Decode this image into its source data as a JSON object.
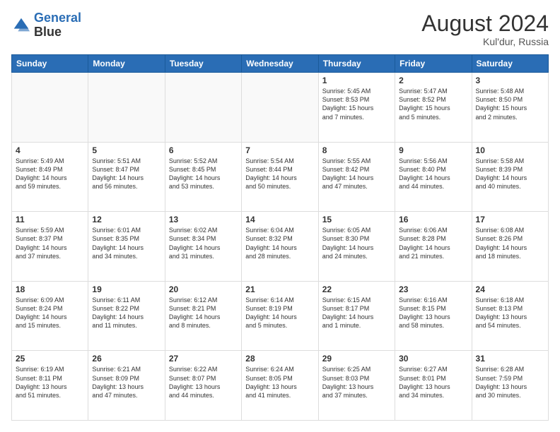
{
  "header": {
    "logo_line1": "General",
    "logo_line2": "Blue",
    "main_title": "August 2024",
    "subtitle": "Kul'dur, Russia"
  },
  "days_of_week": [
    "Sunday",
    "Monday",
    "Tuesday",
    "Wednesday",
    "Thursday",
    "Friday",
    "Saturday"
  ],
  "weeks": [
    [
      {
        "day": "",
        "info": ""
      },
      {
        "day": "",
        "info": ""
      },
      {
        "day": "",
        "info": ""
      },
      {
        "day": "",
        "info": ""
      },
      {
        "day": "1",
        "info": "Sunrise: 5:45 AM\nSunset: 8:53 PM\nDaylight: 15 hours\nand 7 minutes."
      },
      {
        "day": "2",
        "info": "Sunrise: 5:47 AM\nSunset: 8:52 PM\nDaylight: 15 hours\nand 5 minutes."
      },
      {
        "day": "3",
        "info": "Sunrise: 5:48 AM\nSunset: 8:50 PM\nDaylight: 15 hours\nand 2 minutes."
      }
    ],
    [
      {
        "day": "4",
        "info": "Sunrise: 5:49 AM\nSunset: 8:49 PM\nDaylight: 14 hours\nand 59 minutes."
      },
      {
        "day": "5",
        "info": "Sunrise: 5:51 AM\nSunset: 8:47 PM\nDaylight: 14 hours\nand 56 minutes."
      },
      {
        "day": "6",
        "info": "Sunrise: 5:52 AM\nSunset: 8:45 PM\nDaylight: 14 hours\nand 53 minutes."
      },
      {
        "day": "7",
        "info": "Sunrise: 5:54 AM\nSunset: 8:44 PM\nDaylight: 14 hours\nand 50 minutes."
      },
      {
        "day": "8",
        "info": "Sunrise: 5:55 AM\nSunset: 8:42 PM\nDaylight: 14 hours\nand 47 minutes."
      },
      {
        "day": "9",
        "info": "Sunrise: 5:56 AM\nSunset: 8:40 PM\nDaylight: 14 hours\nand 44 minutes."
      },
      {
        "day": "10",
        "info": "Sunrise: 5:58 AM\nSunset: 8:39 PM\nDaylight: 14 hours\nand 40 minutes."
      }
    ],
    [
      {
        "day": "11",
        "info": "Sunrise: 5:59 AM\nSunset: 8:37 PM\nDaylight: 14 hours\nand 37 minutes."
      },
      {
        "day": "12",
        "info": "Sunrise: 6:01 AM\nSunset: 8:35 PM\nDaylight: 14 hours\nand 34 minutes."
      },
      {
        "day": "13",
        "info": "Sunrise: 6:02 AM\nSunset: 8:34 PM\nDaylight: 14 hours\nand 31 minutes."
      },
      {
        "day": "14",
        "info": "Sunrise: 6:04 AM\nSunset: 8:32 PM\nDaylight: 14 hours\nand 28 minutes."
      },
      {
        "day": "15",
        "info": "Sunrise: 6:05 AM\nSunset: 8:30 PM\nDaylight: 14 hours\nand 24 minutes."
      },
      {
        "day": "16",
        "info": "Sunrise: 6:06 AM\nSunset: 8:28 PM\nDaylight: 14 hours\nand 21 minutes."
      },
      {
        "day": "17",
        "info": "Sunrise: 6:08 AM\nSunset: 8:26 PM\nDaylight: 14 hours\nand 18 minutes."
      }
    ],
    [
      {
        "day": "18",
        "info": "Sunrise: 6:09 AM\nSunset: 8:24 PM\nDaylight: 14 hours\nand 15 minutes."
      },
      {
        "day": "19",
        "info": "Sunrise: 6:11 AM\nSunset: 8:22 PM\nDaylight: 14 hours\nand 11 minutes."
      },
      {
        "day": "20",
        "info": "Sunrise: 6:12 AM\nSunset: 8:21 PM\nDaylight: 14 hours\nand 8 minutes."
      },
      {
        "day": "21",
        "info": "Sunrise: 6:14 AM\nSunset: 8:19 PM\nDaylight: 14 hours\nand 5 minutes."
      },
      {
        "day": "22",
        "info": "Sunrise: 6:15 AM\nSunset: 8:17 PM\nDaylight: 14 hours\nand 1 minute."
      },
      {
        "day": "23",
        "info": "Sunrise: 6:16 AM\nSunset: 8:15 PM\nDaylight: 13 hours\nand 58 minutes."
      },
      {
        "day": "24",
        "info": "Sunrise: 6:18 AM\nSunset: 8:13 PM\nDaylight: 13 hours\nand 54 minutes."
      }
    ],
    [
      {
        "day": "25",
        "info": "Sunrise: 6:19 AM\nSunset: 8:11 PM\nDaylight: 13 hours\nand 51 minutes."
      },
      {
        "day": "26",
        "info": "Sunrise: 6:21 AM\nSunset: 8:09 PM\nDaylight: 13 hours\nand 47 minutes."
      },
      {
        "day": "27",
        "info": "Sunrise: 6:22 AM\nSunset: 8:07 PM\nDaylight: 13 hours\nand 44 minutes."
      },
      {
        "day": "28",
        "info": "Sunrise: 6:24 AM\nSunset: 8:05 PM\nDaylight: 13 hours\nand 41 minutes."
      },
      {
        "day": "29",
        "info": "Sunrise: 6:25 AM\nSunset: 8:03 PM\nDaylight: 13 hours\nand 37 minutes."
      },
      {
        "day": "30",
        "info": "Sunrise: 6:27 AM\nSunset: 8:01 PM\nDaylight: 13 hours\nand 34 minutes."
      },
      {
        "day": "31",
        "info": "Sunrise: 6:28 AM\nSunset: 7:59 PM\nDaylight: 13 hours\nand 30 minutes."
      }
    ]
  ]
}
